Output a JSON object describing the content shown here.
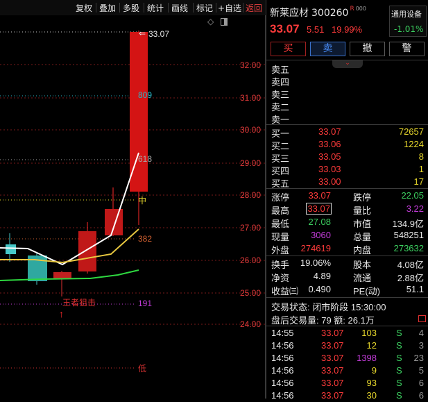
{
  "toolbar": {
    "items": [
      "复权",
      "叠加",
      "多股",
      "统计",
      "画线",
      "标记",
      "+自选",
      "返回"
    ]
  },
  "chart": {
    "price_labels": [
      "32.00",
      "31.00",
      "30.00",
      "29.00",
      "28.00",
      "27.00",
      "26.00",
      "25.00",
      "24.00"
    ],
    "high_label": "33.07",
    "fib_labels": [
      "809",
      "618",
      "中",
      "382",
      "191",
      "低"
    ],
    "annotation": "王者狙击",
    "arrow": "↑",
    "icons": [
      "diamond-icon",
      "window-icon"
    ]
  },
  "stock": {
    "name": "新莱应材",
    "code": "300260",
    "tag": "R",
    "price": "33.07",
    "change": "5.51",
    "change_pct": "19.99%",
    "device_label": "通用设备",
    "device_change": "-1.01%"
  },
  "actions": {
    "buy": "买",
    "sell": "卖",
    "cancel": "撤",
    "alert": "警"
  },
  "asks": [
    {
      "label": "卖五",
      "price": "",
      "vol": ""
    },
    {
      "label": "卖四",
      "price": "",
      "vol": ""
    },
    {
      "label": "卖三",
      "price": "",
      "vol": ""
    },
    {
      "label": "卖二",
      "price": "",
      "vol": ""
    },
    {
      "label": "卖一",
      "price": "",
      "vol": ""
    }
  ],
  "bids": [
    {
      "label": "买一",
      "price": "33.07",
      "vol": "72657"
    },
    {
      "label": "买二",
      "price": "33.06",
      "vol": "1224"
    },
    {
      "label": "买三",
      "price": "33.05",
      "vol": "8"
    },
    {
      "label": "买四",
      "price": "33.03",
      "vol": "1"
    },
    {
      "label": "买五",
      "price": "33.00",
      "vol": "17"
    }
  ],
  "quote": {
    "zt_label": "涨停",
    "zt": "33.07",
    "dt_label": "跌停",
    "dt": "22.05",
    "high_label": "最高",
    "high": "33.07",
    "lb_label": "量比",
    "lb": "3.22",
    "low_label": "最低",
    "low": "27.08",
    "mv_label": "市值",
    "mv": "134.9亿",
    "now_label": "现量",
    "now": "3060",
    "total_label": "总量",
    "total": "548251",
    "out_label": "外盘",
    "out": "274619",
    "in_label": "内盘",
    "in": "273632",
    "turn_label": "换手",
    "turn": "19.06%",
    "cap_label": "股本",
    "cap": "4.08亿",
    "nav_label": "净资",
    "nav": "4.89",
    "float_label": "流通",
    "float": "2.88亿",
    "eps_label": "收益㈢",
    "eps": "0.490",
    "pe_label": "PE(动)",
    "pe": "51.1"
  },
  "status": {
    "line1": "交易状态: 闭市阶段 15:30:00",
    "line2": "盘后交易量: 79  额: 26.1万"
  },
  "trades": [
    {
      "time": "14:55",
      "price": "33.07",
      "vol": "103",
      "side": "S",
      "n": "4"
    },
    {
      "time": "14:56",
      "price": "33.07",
      "vol": "12",
      "side": "S",
      "n": "3"
    },
    {
      "time": "14:56",
      "price": "33.07",
      "vol": "1398",
      "side": "S",
      "n": "23"
    },
    {
      "time": "14:56",
      "price": "33.07",
      "vol": "9",
      "side": "S",
      "n": "5"
    },
    {
      "time": "14:56",
      "price": "33.07",
      "vol": "93",
      "side": "S",
      "n": "6"
    },
    {
      "time": "14:56",
      "price": "33.07",
      "vol": "30",
      "side": "S",
      "n": "6"
    }
  ]
}
